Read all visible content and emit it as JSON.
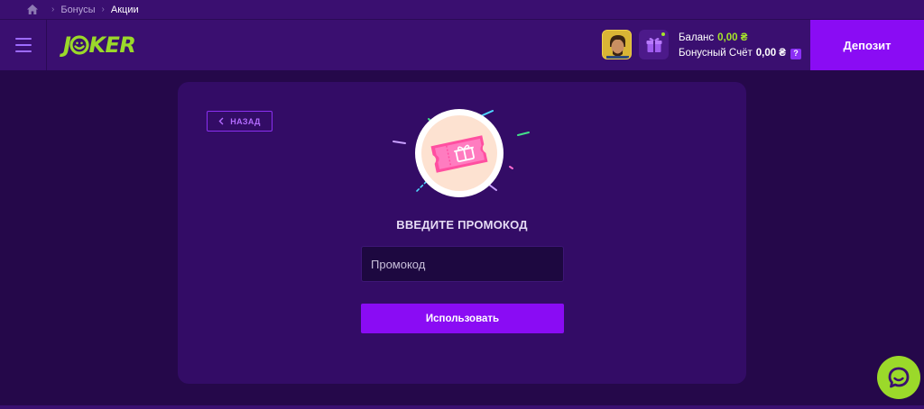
{
  "breadcrumb": {
    "items": [
      "Бонусы",
      "Акции"
    ]
  },
  "header": {
    "logo_text_prefix": "J",
    "logo_text_suffix": "KER",
    "balance_label": "Баланс",
    "balance_value": "0,00 ₴",
    "bonus_label": "Бонусный Счёт",
    "bonus_value": "0,00 ₴",
    "help_label": "?",
    "deposit_label": "Депозит"
  },
  "promo": {
    "back_label": "НАЗАД",
    "title": "ВВЕДИТЕ ПРОМОКОД",
    "input_placeholder": "Промокод",
    "input_value": "",
    "submit_label": "Использовать"
  },
  "icons": {
    "home": "home-icon",
    "menu": "hamburger-menu-icon",
    "gift": "gift-icon",
    "chat": "chat-bubble-icon",
    "back": "chevron-left-icon",
    "promo": "coupon-gift-illustration"
  },
  "colors": {
    "accent": "#8a0cf4",
    "brand_green": "#9bd92a",
    "background": "#25084a",
    "card": "#330c66",
    "header": "#3a0f70"
  }
}
